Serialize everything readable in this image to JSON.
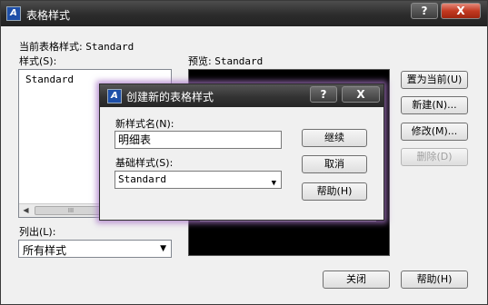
{
  "main": {
    "title": "表格样式",
    "title_buttons": {
      "help": "?",
      "close": "X"
    },
    "current_style_label": "当前表格样式:",
    "current_style_value": "Standard",
    "styles_label": "样式(S):",
    "styles_list": [
      "Standard"
    ],
    "scroll_thumb_label": "III",
    "preview_label": "预览:",
    "preview_value": "Standard",
    "buttons": {
      "set_current": "置为当前(U)",
      "new": "新建(N)...",
      "modify": "修改(M)...",
      "delete": "删除(D)",
      "close": "关闭",
      "help": "帮助(H)"
    },
    "list_label": "列出(L):",
    "list_value": "所有样式"
  },
  "dialog": {
    "title": "创建新的表格样式",
    "title_buttons": {
      "help": "?",
      "close": "X"
    },
    "new_style_label": "新样式名(N):",
    "new_style_value": "明细表",
    "base_style_label": "基础样式(S):",
    "base_style_value": "Standard",
    "buttons": {
      "continue": "继续",
      "cancel": "取消",
      "help": "帮助(H)"
    }
  }
}
